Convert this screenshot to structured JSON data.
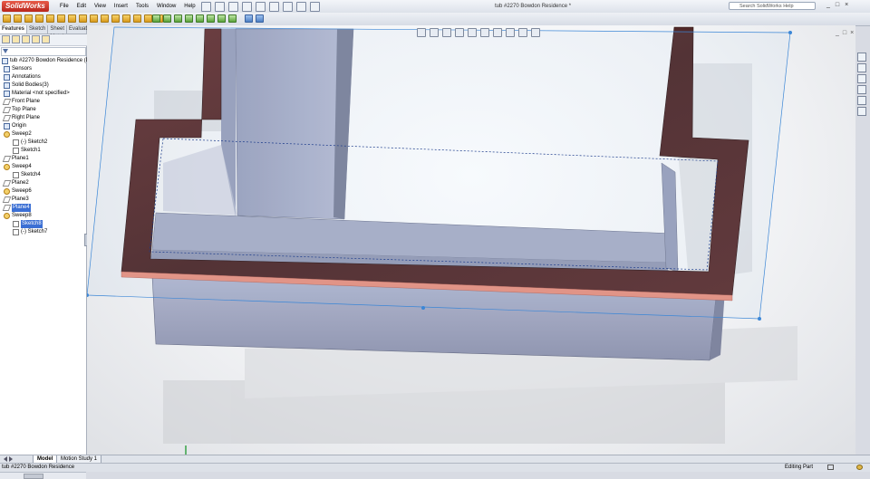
{
  "app": {
    "name": "SolidWorks",
    "doc_title": "tub #2270 Bowdon Residence *"
  },
  "menu": [
    "File",
    "Edit",
    "View",
    "Insert",
    "Tools",
    "Window",
    "Help"
  ],
  "search": {
    "placeholder": "Search SolidWorks Help"
  },
  "window_buttons": [
    "_",
    "□",
    "×"
  ],
  "feature_manager": {
    "tabs": [
      "Features",
      "Sketch",
      "Sheet Metal",
      "Evaluate"
    ],
    "active_tab": "Features",
    "tree": [
      {
        "label": "tub #2270 Bowdon Residence  (D",
        "icon": "part-icon",
        "level": 0
      },
      {
        "label": "Sensors",
        "icon": "sensor-icon",
        "level": 1
      },
      {
        "label": "Annotations",
        "icon": "annotation-icon",
        "level": 1
      },
      {
        "label": "Solid Bodies(3)",
        "icon": "solid-bodies-icon",
        "level": 1
      },
      {
        "label": "Material <not specified>",
        "icon": "material-icon",
        "level": 1
      },
      {
        "label": "Front Plane",
        "icon": "plane-icon",
        "level": 1
      },
      {
        "label": "Top Plane",
        "icon": "plane-icon",
        "level": 1
      },
      {
        "label": "Right Plane",
        "icon": "plane-icon",
        "level": 1
      },
      {
        "label": "Origin",
        "icon": "origin-icon",
        "level": 1
      },
      {
        "label": "Sweep2",
        "icon": "sweep-icon",
        "level": 1
      },
      {
        "label": "(-) Sketch2",
        "icon": "sketch-icon",
        "level": 2
      },
      {
        "label": "Sketch1",
        "icon": "sketch-icon",
        "level": 2
      },
      {
        "label": "Plane1",
        "icon": "plane-icon",
        "level": 1
      },
      {
        "label": "Sweep4",
        "icon": "sweep-icon",
        "level": 1
      },
      {
        "label": "Sketch4",
        "icon": "sketch-icon",
        "level": 2
      },
      {
        "label": "Plane2",
        "icon": "plane-icon",
        "level": 1
      },
      {
        "label": "Sweep6",
        "icon": "sweep-icon",
        "level": 1
      },
      {
        "label": "Plane3",
        "icon": "plane-icon",
        "level": 1
      },
      {
        "label": "Plane4",
        "icon": "plane-icon",
        "level": 1,
        "selected": true
      },
      {
        "label": "Sweep8",
        "icon": "sweep-icon",
        "level": 1
      },
      {
        "label": "Sketch8",
        "icon": "sketch-icon",
        "level": 2,
        "selected": true
      },
      {
        "label": "(-) Sketch7",
        "icon": "sketch-icon",
        "level": 2
      }
    ]
  },
  "bottom_tabs": [
    "Model",
    "Motion Study 1"
  ],
  "status": {
    "left": "tub #2270 Bowdon Residence",
    "right": "Editing Part"
  },
  "colors": {
    "selection": "#3b6fd4",
    "wood": "#5a2e2e",
    "face_pink": "#e48a7a",
    "body": "#a6acc4",
    "sketch_line": "#2f7fd9"
  }
}
